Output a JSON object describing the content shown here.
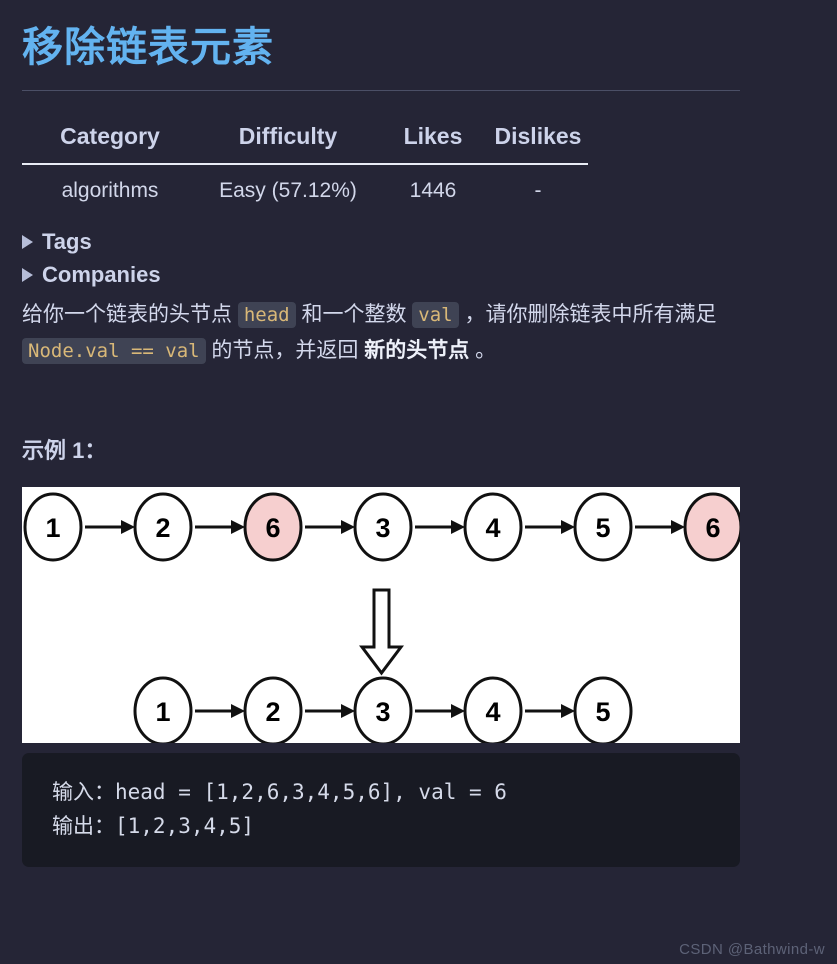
{
  "page": {
    "title": "移除链表元素",
    "background_color": "#252536",
    "title_color": "#63b3f0"
  },
  "meta_table": {
    "headers": [
      "Category",
      "Difficulty",
      "Likes",
      "Dislikes"
    ],
    "row": [
      "algorithms",
      "Easy (57.12%)",
      "1446",
      "-"
    ]
  },
  "collapsibles": [
    {
      "label": "Tags",
      "marker": "triangle-right-icon"
    },
    {
      "label": "Companies",
      "marker": "triangle-right-icon"
    }
  ],
  "description": {
    "seg1": "给你一个链表的头节点 ",
    "code1": "head",
    "seg2": " 和一个整数 ",
    "code2": "val",
    "seg3": " ，请你删除链表中所有满足 ",
    "code3": "Node.val == val",
    "seg4": " 的节点，并返回 ",
    "bold1": "新的头节点",
    "seg5": " 。"
  },
  "example": {
    "heading": "示例 1：",
    "code_lines": "输入：head = [1,2,6,3,4,5,6], val = 6\n输出：[1,2,3,4,5]"
  },
  "diagram": {
    "background": "#ffffff",
    "highlight_fill": "#f6cfcf",
    "node_fill": "#ffffff",
    "stroke": "#111111",
    "top_row": [
      {
        "value": "1",
        "highlight": false
      },
      {
        "value": "2",
        "highlight": false
      },
      {
        "value": "6",
        "highlight": true
      },
      {
        "value": "3",
        "highlight": false
      },
      {
        "value": "4",
        "highlight": false
      },
      {
        "value": "5",
        "highlight": false
      },
      {
        "value": "6",
        "highlight": true
      }
    ],
    "bottom_row": [
      {
        "value": "1",
        "highlight": false
      },
      {
        "value": "2",
        "highlight": false
      },
      {
        "value": "3",
        "highlight": false
      },
      {
        "value": "4",
        "highlight": false
      },
      {
        "value": "5",
        "highlight": false
      }
    ],
    "transition_arrow": "down-arrow-icon"
  },
  "watermark": "CSDN @Bathwind-w"
}
